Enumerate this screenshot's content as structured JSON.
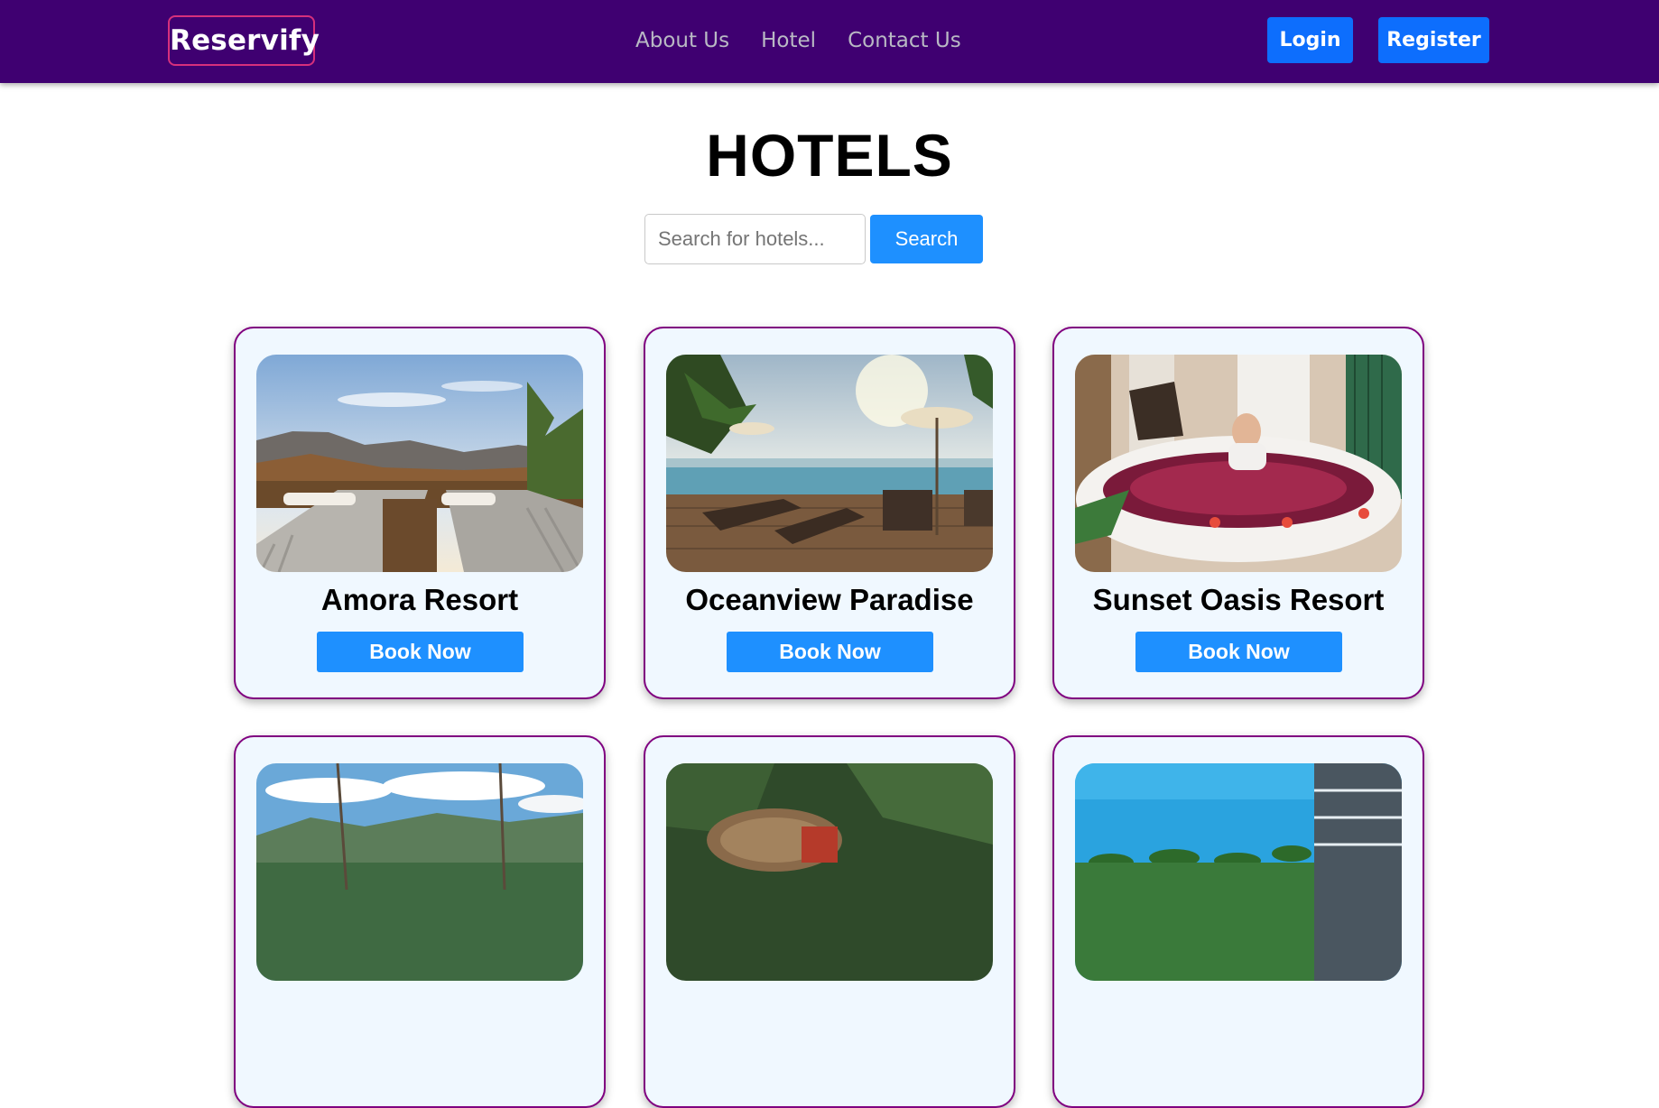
{
  "navbar": {
    "logo": "Reservify",
    "links": [
      "About Us",
      "Hotel",
      "Contact Us"
    ],
    "login_label": "Login",
    "register_label": "Register",
    "background": "#3f0071"
  },
  "main": {
    "title": "HOTELS",
    "search": {
      "placeholder": "Search for hotels...",
      "value": "",
      "button_label": "Search"
    }
  },
  "hotels": [
    {
      "name": "Amora Resort",
      "button": "Book Now",
      "image": "mountain-sunset-loungers"
    },
    {
      "name": "Oceanview Paradise",
      "button": "Book Now",
      "image": "infinity-pool-ocean-deck"
    },
    {
      "name": "Sunset Oasis Resort",
      "button": "Book Now",
      "image": "spa-flower-bath"
    },
    {
      "name": "",
      "button": "",
      "image": "lake-mountain-view"
    },
    {
      "name": "",
      "button": "",
      "image": "forest-treehouse"
    },
    {
      "name": "",
      "button": "",
      "image": "palm-resort-building"
    }
  ],
  "colors": {
    "accent": "#1e90ff",
    "card_border": "#800080",
    "card_background": "#f0f8ff",
    "logo_border": "#d6307c"
  }
}
